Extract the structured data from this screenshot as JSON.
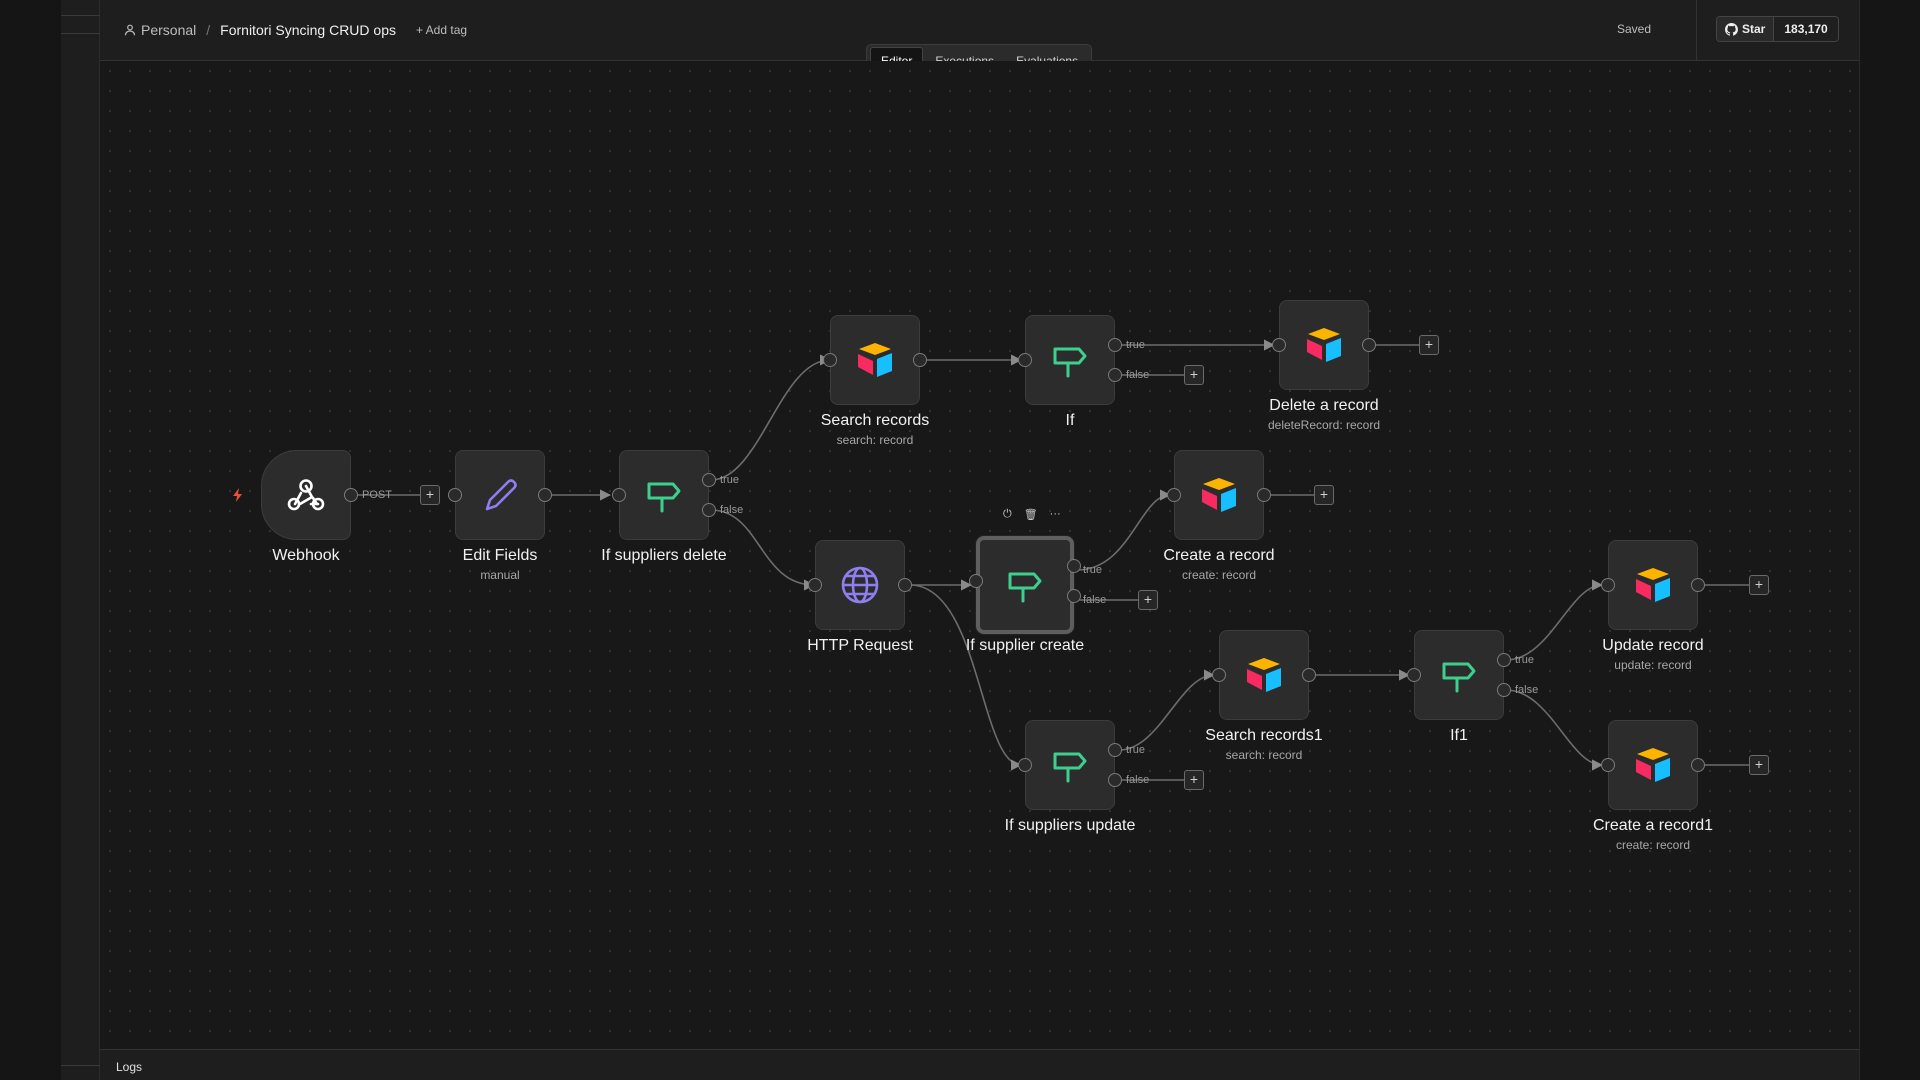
{
  "header": {
    "project": "Personal",
    "separator": "/",
    "workflow_name": "Fornitori Syncing CRUD ops",
    "add_tag": "+ Add tag",
    "save_status": "Saved",
    "github_star": "Star",
    "github_count": "183,170"
  },
  "tabs": [
    {
      "label": "Editor",
      "active": true
    },
    {
      "label": "Executions",
      "active": false
    },
    {
      "label": "Evaluations",
      "active": false
    }
  ],
  "nodes": {
    "webhook": {
      "name": "Webhook",
      "icon": "webhook-icon"
    },
    "edit_fields": {
      "name": "Edit Fields",
      "subtitle": "manual",
      "icon": "pencil-icon"
    },
    "if_suppliers_delete": {
      "name": "If suppliers delete",
      "icon": "signpost-icon"
    },
    "search_records": {
      "name": "Search records",
      "subtitle": "search: record",
      "icon": "airtable-icon"
    },
    "if": {
      "name": "If",
      "icon": "signpost-icon"
    },
    "delete_record": {
      "name": "Delete a record",
      "subtitle": "deleteRecord: record",
      "icon": "airtable-icon"
    },
    "http_request": {
      "name": "HTTP Request",
      "icon": "globe-icon"
    },
    "if_supplier_create": {
      "name": "If supplier create",
      "icon": "signpost-icon"
    },
    "create_record": {
      "name": "Create a record",
      "subtitle": "create: record",
      "icon": "airtable-icon"
    },
    "if_suppliers_update": {
      "name": "If suppliers update",
      "icon": "signpost-icon"
    },
    "search_records1": {
      "name": "Search records1",
      "subtitle": "search: record",
      "icon": "airtable-icon"
    },
    "if1": {
      "name": "If1",
      "icon": "signpost-icon"
    },
    "update_record": {
      "name": "Update record",
      "subtitle": "update: record",
      "icon": "airtable-icon"
    },
    "create_record1": {
      "name": "Create a record1",
      "subtitle": "create: record",
      "icon": "airtable-icon"
    }
  },
  "edge_labels": {
    "post": "POST",
    "true": "true",
    "false": "false"
  },
  "node_toolbar": {
    "power": "⏻",
    "delete": "🗑",
    "more": "···"
  },
  "add_node_symbol": "+",
  "footer": {
    "logs": "Logs"
  },
  "colors": {
    "background": "#181818",
    "node_fill": "#2c2c2c",
    "if_icon": "#3ecf8e",
    "http_icon": "#8e7ef0",
    "trigger_bolt": "#e8503a"
  }
}
